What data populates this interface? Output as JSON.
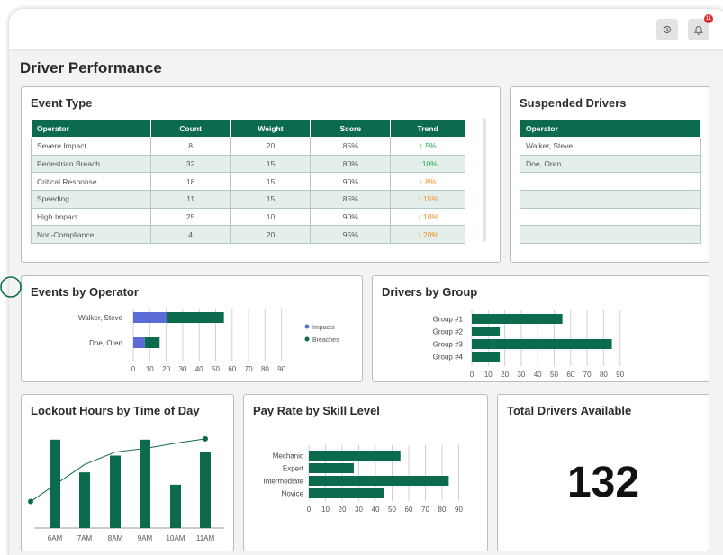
{
  "page_title": "Driver Performance",
  "topbar": {
    "history_icon": "history-icon",
    "bell_icon": "bell-icon",
    "notification_count": "11"
  },
  "event_type": {
    "title": "Event Type",
    "columns": [
      "Operator",
      "Count",
      "Weight",
      "Score",
      "Trend"
    ],
    "rows": [
      {
        "operator": "Severe Impact",
        "count": "8",
        "weight": "20",
        "score": "85%",
        "trend": "↑ 5%",
        "dir": "up"
      },
      {
        "operator": "Pedestrian Breach",
        "count": "32",
        "weight": "15",
        "score": "80%",
        "trend": "↑10%",
        "dir": "up"
      },
      {
        "operator": "Critical Response",
        "count": "18",
        "weight": "15",
        "score": "90%",
        "trend": "↓ 8%",
        "dir": "down"
      },
      {
        "operator": "Speeding",
        "count": "11",
        "weight": "15",
        "score": "85%",
        "trend": "↓ 15%",
        "dir": "down"
      },
      {
        "operator": "High Impact",
        "count": "25",
        "weight": "10",
        "score": "90%",
        "trend": "↓ 10%",
        "dir": "down"
      },
      {
        "operator": "Non-Compliance",
        "count": "4",
        "weight": "20",
        "score": "95%",
        "trend": "↓ 20%",
        "dir": "down"
      }
    ]
  },
  "suspended": {
    "title": "Suspended Drivers",
    "column": "Operator",
    "rows": [
      "Walker, Steve",
      "Doe, Oren",
      "",
      "",
      "",
      ""
    ]
  },
  "events_by_operator": {
    "title": "Events by Operator",
    "ticks": [
      "0",
      "10",
      "20",
      "30",
      "40",
      "50",
      "60",
      "70",
      "80",
      "90"
    ],
    "legend": [
      "Impacts",
      "Breaches"
    ]
  },
  "drivers_by_group": {
    "title": "Drivers by Group",
    "ticks": [
      "0",
      "10",
      "20",
      "30",
      "40",
      "50",
      "60",
      "70",
      "80",
      "90"
    ]
  },
  "lockout": {
    "title": "Lockout Hours by Time of Day",
    "ticks": [
      "6AM",
      "7AM",
      "8AM",
      "9AM",
      "10AM",
      "11AM"
    ]
  },
  "pay_rate": {
    "title": "Pay Rate by Skill Level",
    "ticks": [
      "0",
      "10",
      "20",
      "30",
      "40",
      "50",
      "60",
      "70",
      "80",
      "90"
    ]
  },
  "total_drivers": {
    "title": "Total Drivers Available",
    "value": "132"
  },
  "colors": {
    "primary": "#0c6b4f",
    "impacts": "#5c6bd8",
    "up": "#1faa4a",
    "down": "#f08a24"
  },
  "chart_data": [
    {
      "type": "bar",
      "orientation": "horizontal",
      "stacked": true,
      "categories": [
        "Walker, Steve",
        "Doe, Oren"
      ],
      "series": [
        {
          "name": "Impacts",
          "values": [
            20,
            7
          ]
        },
        {
          "name": "Breaches",
          "values": [
            35,
            9
          ]
        }
      ],
      "xlim": [
        0,
        90
      ],
      "legend": "right"
    },
    {
      "type": "bar",
      "orientation": "horizontal",
      "categories": [
        "Group #1",
        "Group #2",
        "Group #3",
        "Group #4"
      ],
      "values": [
        55,
        17,
        85,
        17
      ],
      "xlim": [
        0,
        90
      ]
    },
    {
      "type": "bar",
      "categories": [
        "6AM",
        "7AM",
        "8AM",
        "9AM",
        "10AM",
        "11AM"
      ],
      "values": [
        100,
        63,
        82,
        100,
        49,
        86
      ],
      "line_values": [
        30,
        72,
        86,
        90,
        96,
        101
      ],
      "ylim": [
        0,
        110
      ]
    },
    {
      "type": "bar",
      "orientation": "horizontal",
      "categories": [
        "Mechanic",
        "Expert",
        "Intermediate",
        "Novice"
      ],
      "values": [
        55,
        27,
        84,
        45
      ],
      "xlim": [
        0,
        90
      ]
    }
  ]
}
